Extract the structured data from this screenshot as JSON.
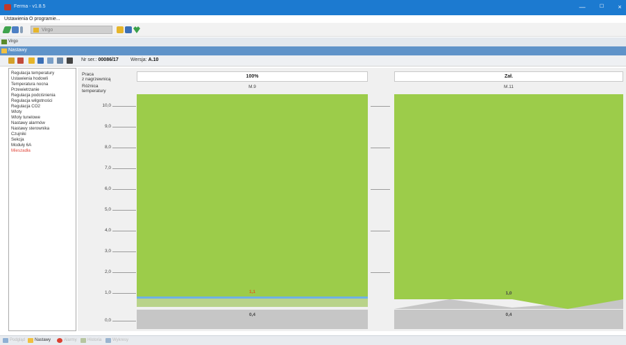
{
  "window": {
    "title": "Ferma - v1.8.5",
    "minimize": "—",
    "maximize": "☐",
    "close": "×"
  },
  "menu": {
    "items": [
      "Ustawienia",
      "O programie..."
    ]
  },
  "toolbar": {
    "device_combo": "Virgo"
  },
  "section": {
    "title": "Virgo"
  },
  "tab_header": {
    "title": "Nastawy"
  },
  "device_info": {
    "serial_label": "Nr ser.:",
    "serial": "00086/17",
    "version_label": "Wersja:",
    "version": "A.10"
  },
  "sidebar": {
    "items": [
      {
        "label": "Regulacja temperatury",
        "active": false
      },
      {
        "label": "Ustawienia hodowli",
        "active": false
      },
      {
        "label": "Temperatura nocna",
        "active": false
      },
      {
        "label": "Przewietrzanie",
        "active": false
      },
      {
        "label": "Regulacja podciśnienia",
        "active": false
      },
      {
        "label": "Regulacja wilgotności",
        "active": false
      },
      {
        "label": "Regulacja CO2",
        "active": false
      },
      {
        "label": "Wloty",
        "active": false
      },
      {
        "label": "Wloty tunelowe",
        "active": false
      },
      {
        "label": "Nastawy alarmów",
        "active": false
      },
      {
        "label": "Nastawy sterownika",
        "active": false
      },
      {
        "label": "Czujniki",
        "active": false
      },
      {
        "label": "Sekcja",
        "active": false
      },
      {
        "label": "Moduły 6A",
        "active": false
      },
      {
        "label": "Mieszadła",
        "active": true
      }
    ]
  },
  "content": {
    "row1_label": "Praca\nz nagrzewnicą",
    "row2_label": "Różnica\ntemperatury",
    "axis_ticks": [
      "10,0",
      "9,0",
      "8,0",
      "7,0",
      "6,0",
      "5,0",
      "4,0",
      "3,0",
      "2,0",
      "1,0",
      "0,0"
    ],
    "panels": [
      {
        "work": "100%",
        "module": "M.9",
        "value_label": "1,1",
        "bottom_label": "0,4",
        "value": 1.1,
        "value_color": "#e05a1f"
      },
      {
        "work": "Zał.",
        "module": "M.11",
        "value_label": "1,0",
        "bottom_label": "0,4",
        "value": 1.0,
        "value_color": "#333333"
      }
    ]
  },
  "statusbar": {
    "items": [
      {
        "label": "Podgląd",
        "active": false
      },
      {
        "label": "Nastawy",
        "active": true
      },
      {
        "label": "Alarmy",
        "active": false
      },
      {
        "label": "Historia",
        "active": false
      },
      {
        "label": "Wykresy",
        "active": false
      }
    ]
  },
  "colors": {
    "bar_green": "#9ccc4a",
    "header_blue": "#1c7ad0",
    "tab_blue": "#5f93c9",
    "alarm_red": "#e0483c"
  }
}
